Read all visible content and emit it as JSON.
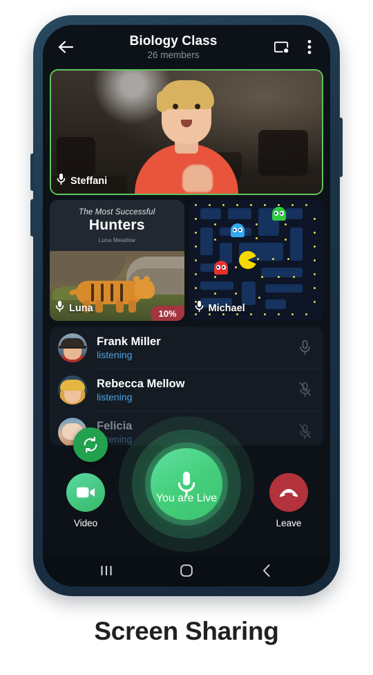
{
  "header": {
    "back_icon": "back-arrow-icon",
    "title": "Biology Class",
    "members": "26 members",
    "share_screen_icon": "screen-share-icon",
    "menu_icon": "more-vertical-icon"
  },
  "colors": {
    "active_speaker_border": "#5ec75e",
    "accent_green": "#45cf7c",
    "leave_red": "#b3323b",
    "status_blue": "#4ea3e0",
    "screen_bg": "#0d1218",
    "panel_bg": "#141b23",
    "frame_navy": "#1c3347",
    "badge_red": "#a3363f"
  },
  "video_tiles": {
    "main": {
      "name": "Steffani",
      "mic_icon": "microphone-icon",
      "active_speaker": true
    },
    "secondary": [
      {
        "name": "Luna",
        "mic_icon": "microphone-icon",
        "type": "presentation",
        "slide_eyebrow": "The Most Successful",
        "slide_title": "Hunters",
        "slide_author": "Luna Meadow",
        "badge": "10%"
      },
      {
        "name": "Michael",
        "mic_icon": "microphone-icon",
        "type": "game",
        "game": "pac-man"
      }
    ]
  },
  "participants": [
    {
      "name": "Frank Miller",
      "status": "listening",
      "mic_icon": "microphone-icon",
      "muted": false
    },
    {
      "name": "Rebecca Mellow",
      "status": "listening",
      "mic_icon": "microphone-muted-icon",
      "muted": true
    },
    {
      "name": "Felicia",
      "status": "listening",
      "mic_icon": "microphone-muted-icon",
      "muted": true
    }
  ],
  "controls": {
    "flip_camera_icon": "flip-camera-icon",
    "video_label": "Video",
    "video_icon": "video-camera-icon",
    "live_label": "You are Live",
    "live_icon": "microphone-icon",
    "leave_label": "Leave",
    "leave_icon": "hang-up-icon"
  },
  "nav_bar": {
    "recents_icon": "recents-icon",
    "home_icon": "home-icon",
    "back_icon": "back-chevron-icon"
  },
  "caption": "Screen Sharing"
}
